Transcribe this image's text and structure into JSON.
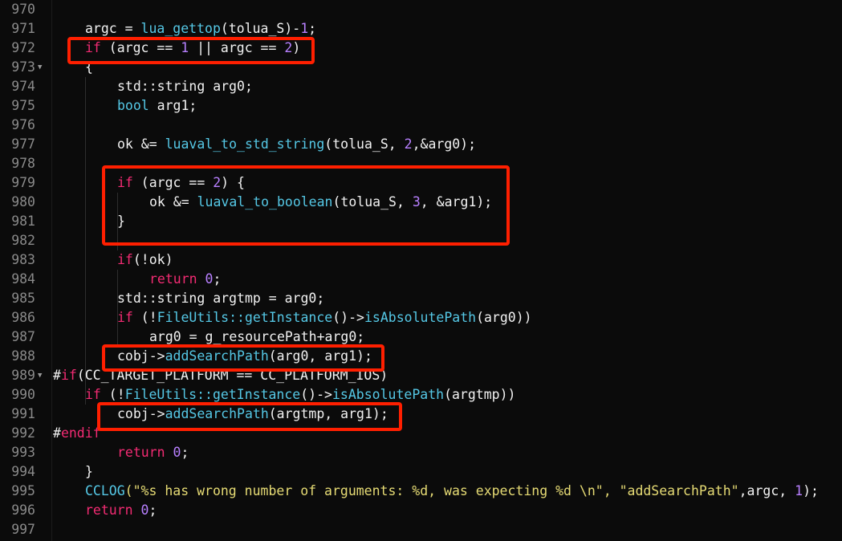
{
  "colors": {
    "background": "#0b0b0b",
    "default": "#f2f2f2",
    "keyword": "#f32b73",
    "function": "#55c8e6",
    "number": "#b880ff",
    "string": "#e6db74",
    "line_number": "#8a8a8a",
    "highlight": "#ff1f00"
  },
  "lines": [
    {
      "num": "970",
      "fold": false,
      "indent": 0,
      "tokens": []
    },
    {
      "num": "971",
      "fold": false,
      "indent": 1,
      "tokens": [
        {
          "t": "argc = "
        },
        {
          "t": "lua_gettop",
          "c": "fn"
        },
        {
          "t": "(tolua_S)-"
        },
        {
          "t": "1",
          "c": "num"
        },
        {
          "t": ";"
        }
      ]
    },
    {
      "num": "972",
      "fold": false,
      "indent": 1,
      "tokens": [
        {
          "t": "if",
          "c": "kw"
        },
        {
          "t": " (argc == "
        },
        {
          "t": "1",
          "c": "num"
        },
        {
          "t": " || argc == "
        },
        {
          "t": "2",
          "c": "num"
        },
        {
          "t": ")"
        }
      ]
    },
    {
      "num": "973",
      "fold": true,
      "indent": 1,
      "tokens": [
        {
          "t": "{"
        }
      ]
    },
    {
      "num": "974",
      "fold": false,
      "indent": 2,
      "tokens": [
        {
          "t": "std::string arg0;"
        }
      ]
    },
    {
      "num": "975",
      "fold": false,
      "indent": 2,
      "tokens": [
        {
          "t": "bool",
          "c": "fn"
        },
        {
          "t": " arg1;"
        }
      ]
    },
    {
      "num": "976",
      "fold": false,
      "indent": 0,
      "tokens": []
    },
    {
      "num": "977",
      "fold": false,
      "indent": 2,
      "tokens": [
        {
          "t": "ok &= "
        },
        {
          "t": "luaval_to_std_string",
          "c": "fn"
        },
        {
          "t": "(tolua_S, "
        },
        {
          "t": "2",
          "c": "num"
        },
        {
          "t": ",&arg0);"
        }
      ]
    },
    {
      "num": "978",
      "fold": false,
      "indent": 0,
      "tokens": []
    },
    {
      "num": "979",
      "fold": false,
      "indent": 2,
      "tokens": [
        {
          "t": "if",
          "c": "kw"
        },
        {
          "t": " (argc == "
        },
        {
          "t": "2",
          "c": "num"
        },
        {
          "t": ") {"
        }
      ]
    },
    {
      "num": "980",
      "fold": false,
      "indent": 3,
      "tokens": [
        {
          "t": "ok &= "
        },
        {
          "t": "luaval_to_boolean",
          "c": "fn"
        },
        {
          "t": "(tolua_S, "
        },
        {
          "t": "3",
          "c": "num"
        },
        {
          "t": ", &arg1);"
        }
      ]
    },
    {
      "num": "981",
      "fold": false,
      "indent": 2,
      "tokens": [
        {
          "t": "}"
        }
      ]
    },
    {
      "num": "982",
      "fold": false,
      "indent": 0,
      "tokens": []
    },
    {
      "num": "983",
      "fold": false,
      "indent": 2,
      "tokens": [
        {
          "t": "if",
          "c": "kw"
        },
        {
          "t": "(!ok)"
        }
      ]
    },
    {
      "num": "984",
      "fold": false,
      "indent": 3,
      "tokens": [
        {
          "t": "return",
          "c": "kw"
        },
        {
          "t": " "
        },
        {
          "t": "0",
          "c": "num"
        },
        {
          "t": ";"
        }
      ]
    },
    {
      "num": "985",
      "fold": false,
      "indent": 2,
      "tokens": [
        {
          "t": "std::string argtmp = arg0;"
        }
      ]
    },
    {
      "num": "986",
      "fold": false,
      "indent": 2,
      "tokens": [
        {
          "t": "if",
          "c": "kw"
        },
        {
          "t": " (!"
        },
        {
          "t": "FileUtils::getInstance",
          "c": "fn"
        },
        {
          "t": "()->"
        },
        {
          "t": "isAbsolutePath",
          "c": "fn"
        },
        {
          "t": "(arg0))"
        }
      ]
    },
    {
      "num": "987",
      "fold": false,
      "indent": 3,
      "tokens": [
        {
          "t": "arg0 = g_resourcePath+arg0;"
        }
      ]
    },
    {
      "num": "988",
      "fold": false,
      "indent": 2,
      "tokens": [
        {
          "t": "cobj->"
        },
        {
          "t": "addSearchPath",
          "c": "fn"
        },
        {
          "t": "(arg0, arg1);"
        }
      ]
    },
    {
      "num": "989",
      "fold": true,
      "indent": 0,
      "tokens": [
        {
          "t": "#"
        },
        {
          "t": "if",
          "c": "kw"
        },
        {
          "t": "(CC_TARGET_PLATFORM == CC_PLATFORM_IOS)"
        }
      ]
    },
    {
      "num": "990",
      "fold": false,
      "indent": 1,
      "tokens": [
        {
          "t": "if",
          "c": "kw"
        },
        {
          "t": " (!"
        },
        {
          "t": "FileUtils::getInstance",
          "c": "fn"
        },
        {
          "t": "()->"
        },
        {
          "t": "isAbsolutePath",
          "c": "fn"
        },
        {
          "t": "(argtmp))"
        }
      ]
    },
    {
      "num": "991",
      "fold": false,
      "indent": 2,
      "tokens": [
        {
          "t": "cobj->"
        },
        {
          "t": "addSearchPath",
          "c": "fn"
        },
        {
          "t": "(argtmp, arg1);"
        }
      ]
    },
    {
      "num": "992",
      "fold": false,
      "indent": 0,
      "tokens": [
        {
          "t": "#"
        },
        {
          "t": "endif",
          "c": "kw"
        }
      ]
    },
    {
      "num": "993",
      "fold": false,
      "indent": 2,
      "tokens": [
        {
          "t": "return",
          "c": "kw"
        },
        {
          "t": " "
        },
        {
          "t": "0",
          "c": "num"
        },
        {
          "t": ";"
        }
      ]
    },
    {
      "num": "994",
      "fold": false,
      "indent": 1,
      "tokens": [
        {
          "t": "}"
        }
      ]
    },
    {
      "num": "995",
      "fold": false,
      "indent": 1,
      "tokens": [
        {
          "t": "CCLOG",
          "c": "fn"
        },
        {
          "t": "(\"%s has wrong number of arguments: %d, was expecting %d \\n\", \"addSearchPath\"",
          "c": "str"
        },
        {
          "t": ",argc, "
        },
        {
          "t": "1",
          "c": "num"
        },
        {
          "t": ");"
        }
      ]
    },
    {
      "num": "996",
      "fold": false,
      "indent": 1,
      "tokens": [
        {
          "t": "return",
          "c": "kw"
        },
        {
          "t": " "
        },
        {
          "t": "0",
          "c": "num"
        },
        {
          "t": ";"
        }
      ]
    },
    {
      "num": "997",
      "fold": false,
      "indent": 0,
      "tokens": []
    }
  ]
}
